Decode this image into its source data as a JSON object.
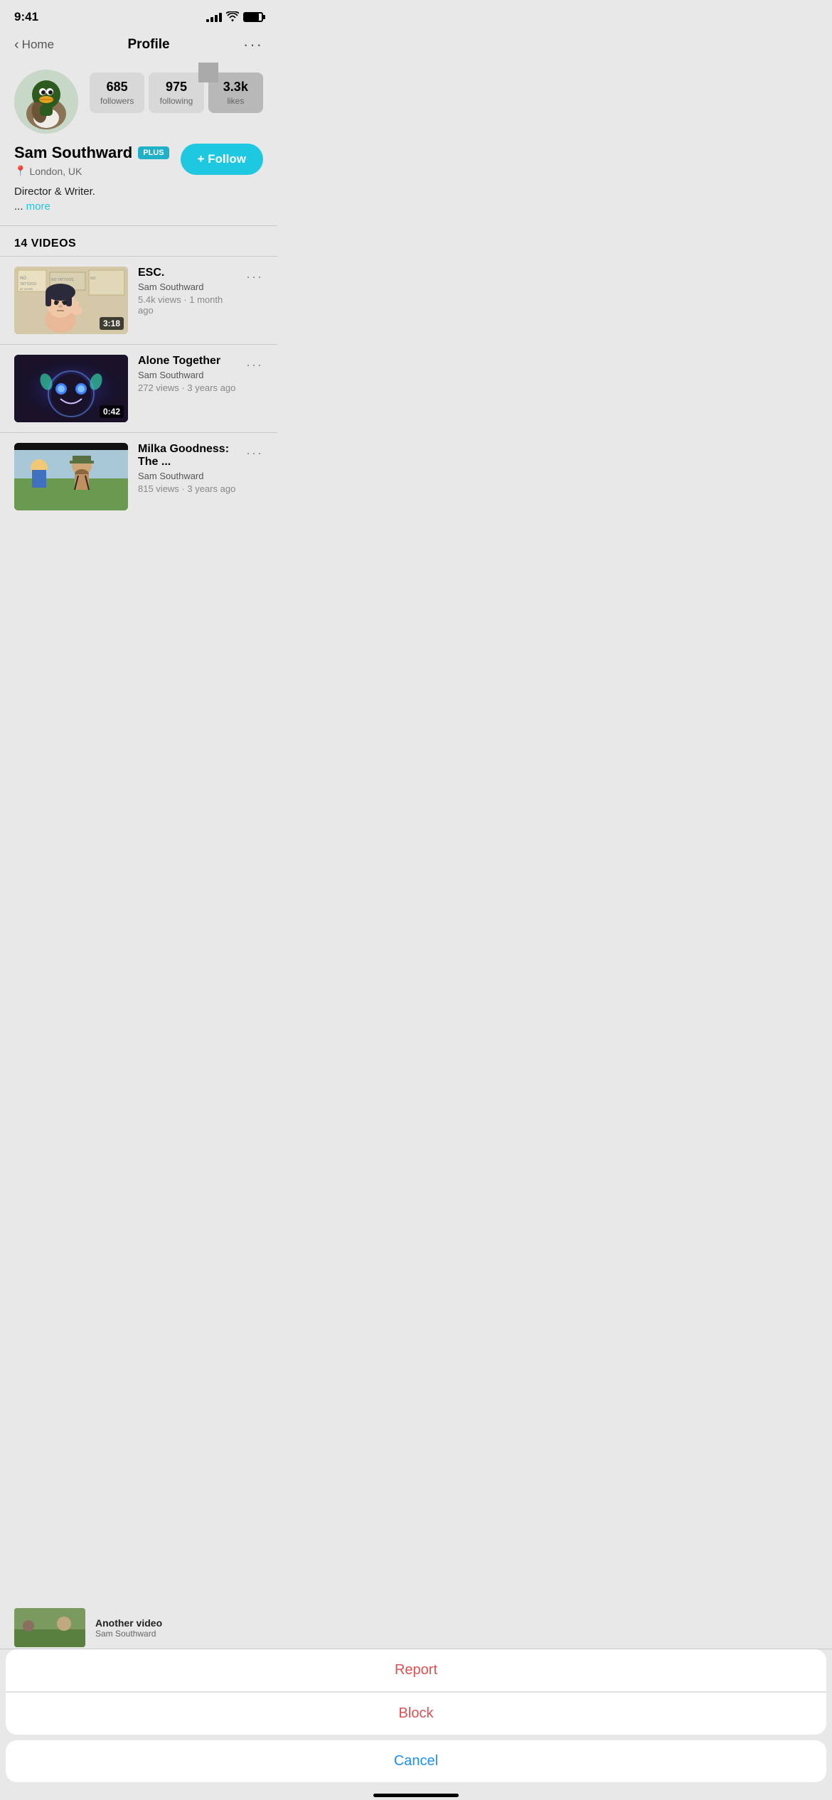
{
  "statusBar": {
    "time": "9:41"
  },
  "nav": {
    "back": "Home",
    "title": "Profile",
    "more": "···"
  },
  "profile": {
    "name": "Sam Southward",
    "badge": "PLUS",
    "location": "London, UK",
    "bio": "Director & Writer.",
    "bioMore": "more",
    "followBtn": "+ Follow",
    "stats": {
      "followers": {
        "number": "685",
        "label": "followers"
      },
      "following": {
        "number": "975",
        "label": "following"
      },
      "likes": {
        "number": "3.3k",
        "label": "likes"
      }
    }
  },
  "videosSection": {
    "header": "14 VIDEOS"
  },
  "videos": [
    {
      "title": "ESC.",
      "author": "Sam Southward",
      "meta": "5.4k views · 1 month ago",
      "duration": "3:18",
      "thumbType": "esc"
    },
    {
      "title": "Alone Together",
      "author": "Sam Southward",
      "meta": "272 views · 3 years ago",
      "duration": "0:42",
      "thumbType": "alone"
    },
    {
      "title": "Milka Goodness: The ...",
      "author": "Sam Southward",
      "meta": "815 views · 3 years ago",
      "duration": "",
      "thumbType": "milka"
    }
  ],
  "actionSheet": {
    "report": "Report",
    "block": "Block",
    "cancel": "Cancel"
  }
}
